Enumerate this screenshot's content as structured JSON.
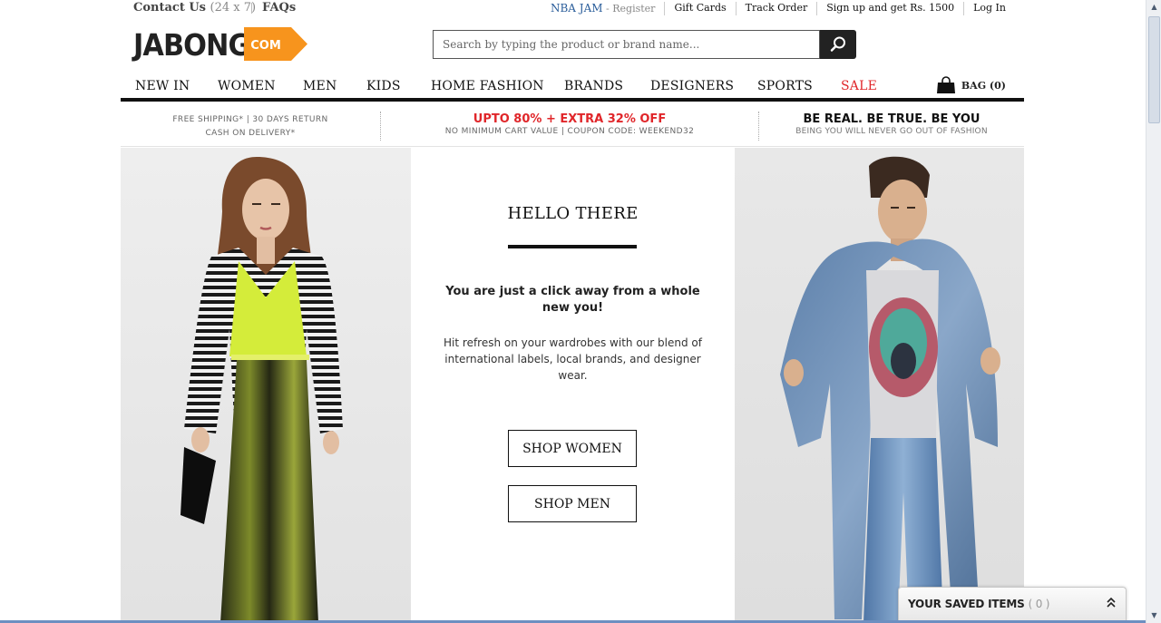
{
  "topbar": {
    "contact_label": "Contact Us",
    "contact_hours": "(24 x 7)",
    "faqs": "FAQs",
    "nba_jam": "NBA JAM",
    "register": "- Register",
    "gift_cards": "Gift Cards",
    "track_order": "Track Order",
    "signup": "Sign up and get Rs. 1500",
    "login": "Log In"
  },
  "logo": {
    "text": "JABONG",
    "badge": "COM",
    "badge_color": "#f7941d"
  },
  "search": {
    "placeholder": "Search by typing the product or brand name..."
  },
  "nav": {
    "items": [
      "NEW IN",
      "WOMEN",
      "MEN",
      "KIDS",
      "HOME FASHION",
      "BRANDS",
      "DESIGNERS",
      "SPORTS",
      "SALE"
    ],
    "bag_label": "BAG (0)"
  },
  "promo": {
    "shipping_line1": "FREE SHIPPING* | 30 DAYS RETURN",
    "shipping_line2": "CASH ON DELIVERY*",
    "offer_headline": "UPTO 80% + EXTRA 32% OFF",
    "offer_sub": "NO MINIMUM CART VALUE | COUPON CODE: WEEKEND32",
    "slogan_headline": "BE REAL. BE TRUE. BE YOU",
    "slogan_sub": "BEING YOU WILL NEVER GO OUT OF FASHION"
  },
  "hero": {
    "title": "HELLO THERE",
    "tagline": "You are just a click away from a whole new you!",
    "blurb": "Hit refresh on your wardrobes with our blend of international labels, local brands, and designer wear.",
    "shop_women": "SHOP WOMEN",
    "shop_men": "SHOP MEN"
  },
  "saved_items": {
    "label": "YOUR SAVED ITEMS",
    "count": "( 0 )"
  },
  "colors": {
    "sale_red": "#e0262a",
    "accent_orange": "#f7941d",
    "link_blue": "#2a5d9a"
  }
}
